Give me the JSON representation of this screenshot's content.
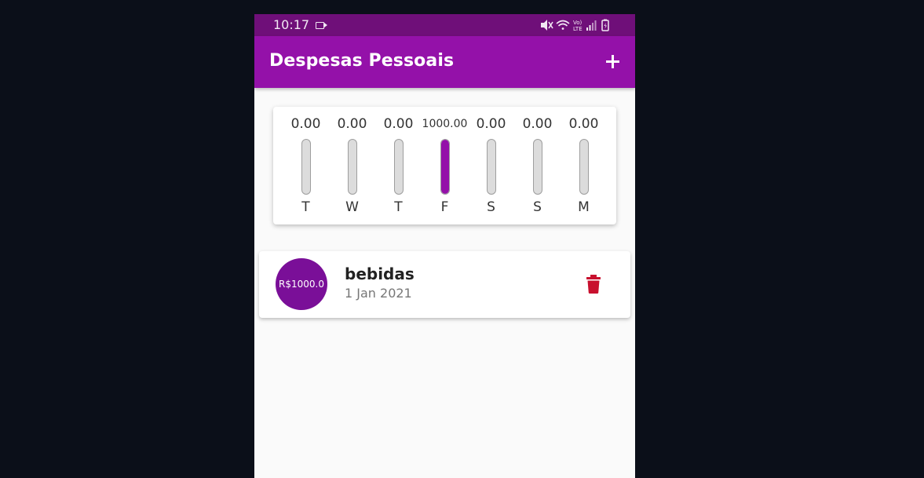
{
  "status_bar": {
    "time": "10:17",
    "icons": [
      "video-camera-icon",
      "mute-icon",
      "wifi-icon",
      "volte-icon",
      "signal-icon",
      "battery-icon"
    ],
    "color": "#6f0f79"
  },
  "app_bar": {
    "title": "Despesas Pessoais",
    "add_icon": "plus-icon",
    "color": "#9411a9"
  },
  "chart": {
    "bars": [
      {
        "day": "T",
        "value_label": "0.00",
        "fill": 0
      },
      {
        "day": "W",
        "value_label": "0.00",
        "fill": 0
      },
      {
        "day": "T",
        "value_label": "0.00",
        "fill": 0
      },
      {
        "day": "F",
        "value_label": "1000.00",
        "fill": 1
      },
      {
        "day": "S",
        "value_label": "0.00",
        "fill": 0
      },
      {
        "day": "S",
        "value_label": "0.00",
        "fill": 0
      },
      {
        "day": "M",
        "value_label": "0.00",
        "fill": 0
      }
    ],
    "fill_color": "#9411a9"
  },
  "transactions": [
    {
      "amount": "R$1000.0",
      "title": "bebidas",
      "date": "1 Jan 2021",
      "delete_icon": "trash-icon",
      "delete_color": "#c8102e"
    }
  ]
}
